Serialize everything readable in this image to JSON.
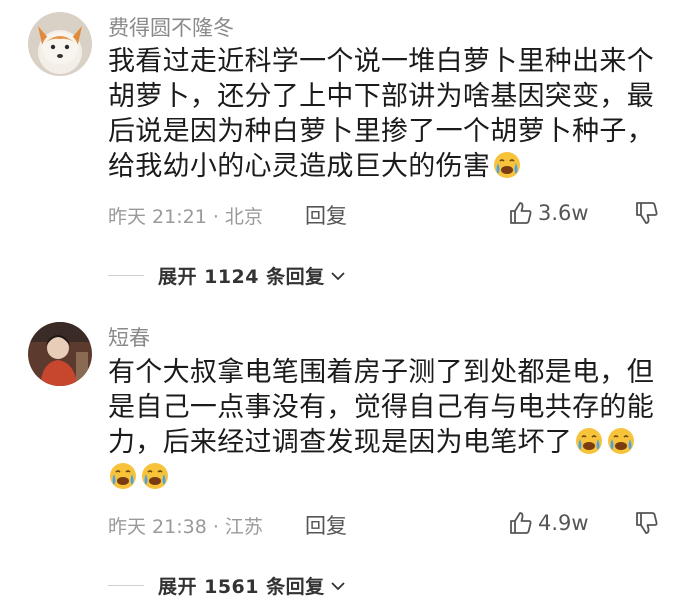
{
  "comments": [
    {
      "username": "费得圆不隆冬",
      "avatar": "fox-avatar",
      "lines": [
        "我看过走近科学一个说一堆白萝卜里种出来个",
        "胡萝卜，还分了上中下部讲为啥基因突变，最",
        "后说是因为种白萝卜里掺了一个胡萝卜种子，",
        "给我幼小的心灵造成巨大的伤害"
      ],
      "time": "昨天 21:21 · 北京",
      "reply_label": "回复",
      "likes": "3.6w",
      "expand_label": "展开 1124 条回复"
    },
    {
      "username": "短春",
      "avatar": "portrait-avatar",
      "lines": [
        "有个大叔拿电笔围着房子测了到处都是电，但",
        "是自己一点事没有，觉得自己有与电共存的能",
        "力，后来经过调查发现是因为电笔坏了"
      ],
      "time": "昨天 21:38 · 江苏",
      "reply_label": "回复",
      "likes": "4.9w",
      "expand_label": "展开 1561 条回复"
    }
  ],
  "icons": {
    "like": "thumbs-up-icon",
    "dislike": "thumbs-down-icon",
    "expand": "chevron-down-icon",
    "emoji": "crying-face-emoji"
  },
  "colors": {
    "meta": "#9a9a9a",
    "emoji_face": "#f6c33b",
    "emoji_tears": "#4aa3e8"
  }
}
